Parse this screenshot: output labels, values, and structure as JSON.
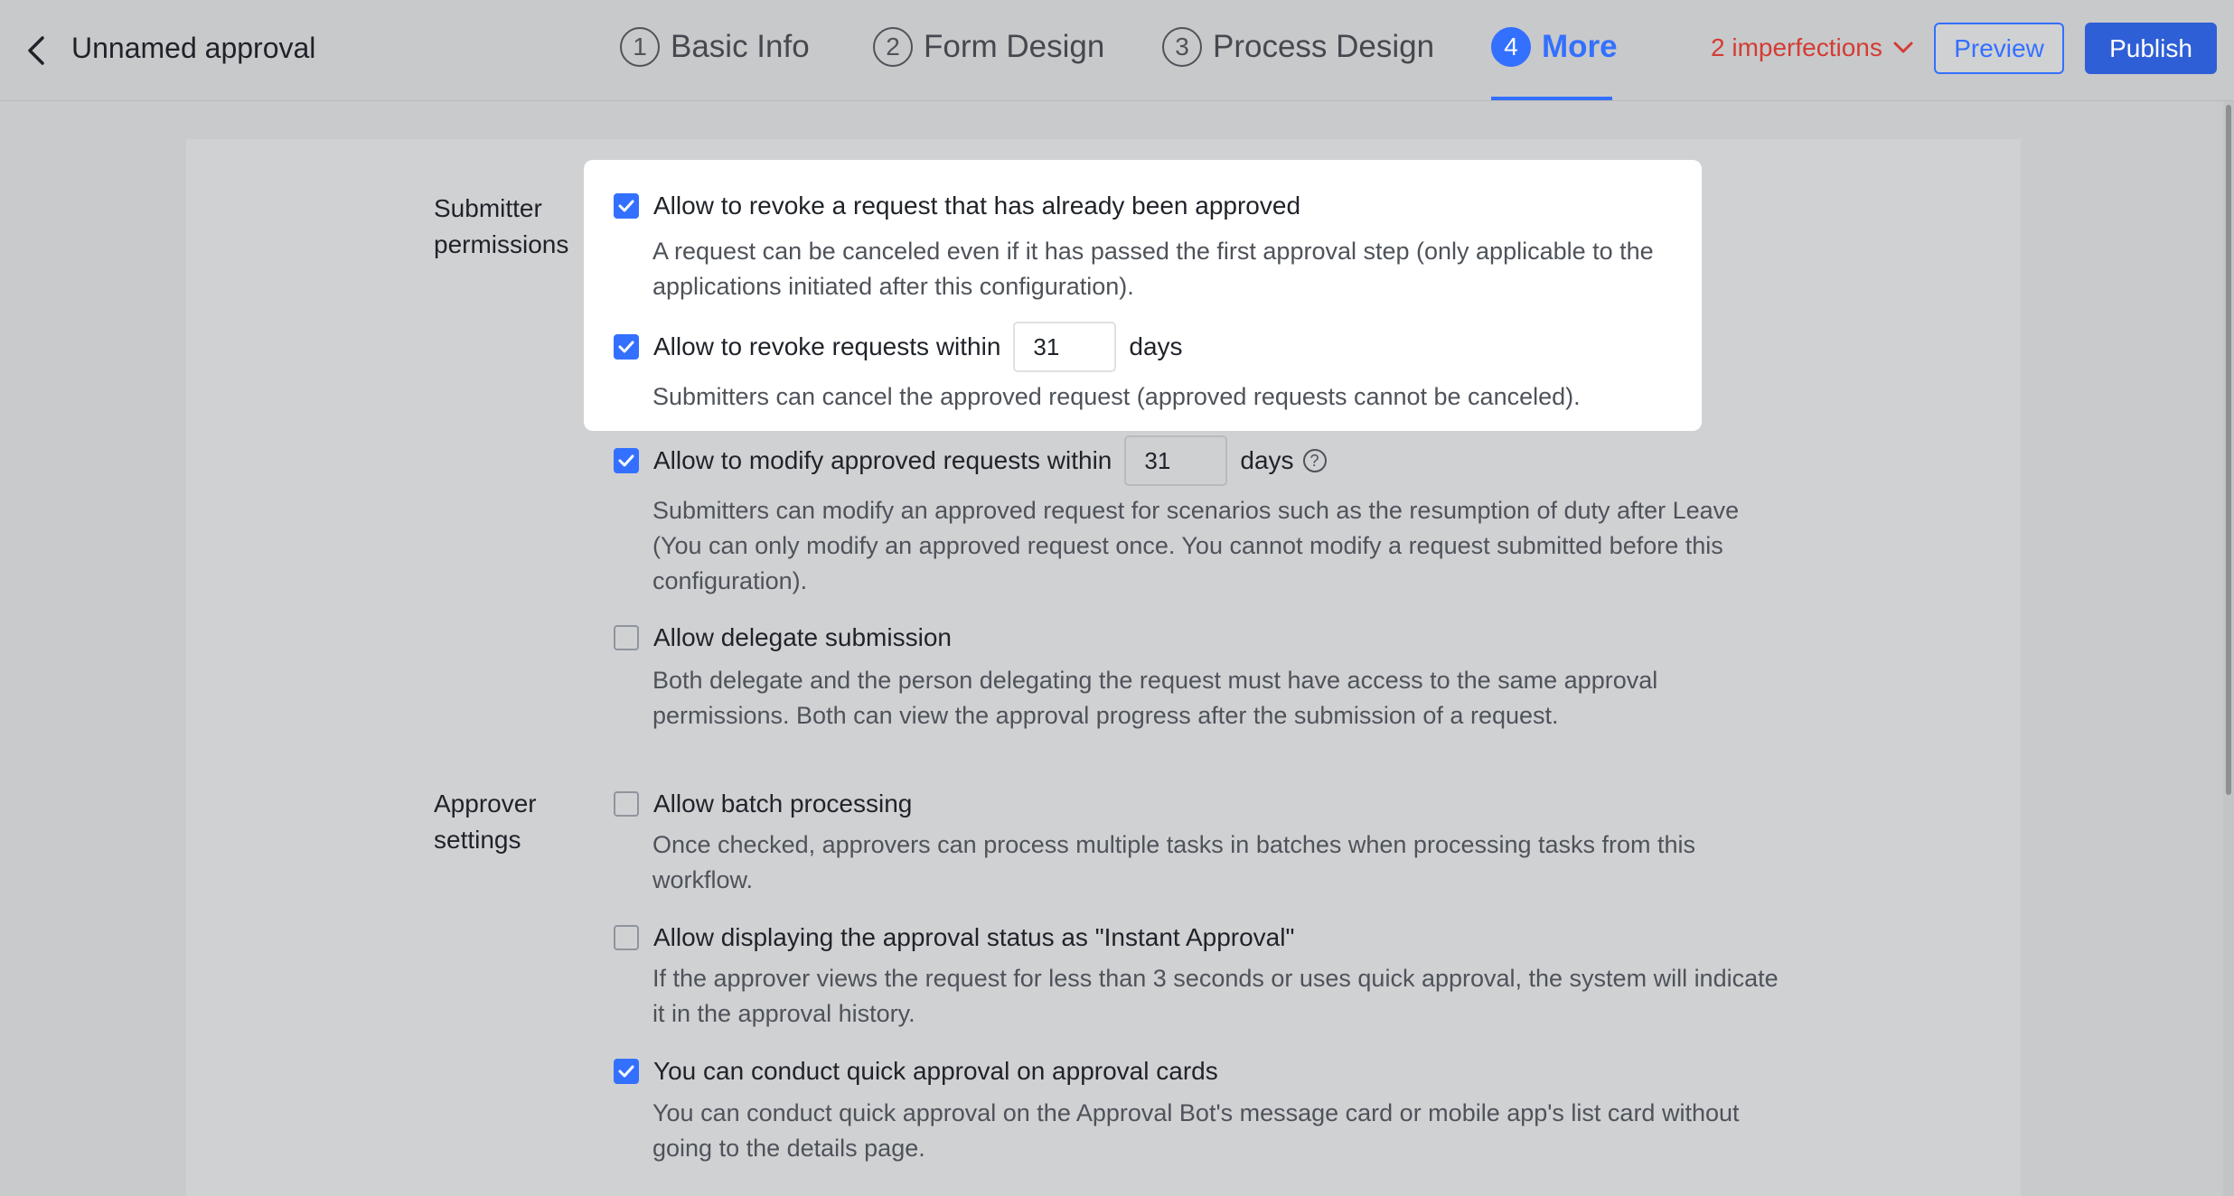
{
  "header": {
    "title": "Unnamed approval",
    "steps": [
      {
        "num": "1",
        "label": "Basic Info"
      },
      {
        "num": "2",
        "label": "Form Design"
      },
      {
        "num": "3",
        "label": "Process Design"
      },
      {
        "num": "4",
        "label": "More"
      }
    ],
    "active_step": 4,
    "imperfections": "2 imperfections",
    "preview": "Preview",
    "publish": "Publish"
  },
  "submitter": {
    "label": "Submitter permissions",
    "options": [
      {
        "label": "Allow to revoke a request that has already been approved",
        "checked": true,
        "desc": [
          "A request can be canceled even if it has passed the first approval step (only applicable to the",
          "applications initiated after this configuration)."
        ]
      },
      {
        "label": "Allow to revoke requests within",
        "value": "31",
        "unit": "days",
        "checked": true,
        "desc": [
          "Submitters can cancel the approved request (approved requests cannot be canceled)."
        ]
      },
      {
        "label": "Allow to modify approved requests within",
        "value": "31",
        "unit": "days",
        "checked": true,
        "desc": [
          "Submitters can modify an approved request for scenarios such as the resumption of duty after Leave",
          "(You can only modify an approved request once. You cannot modify a request submitted before this",
          "configuration)."
        ]
      },
      {
        "label": "Allow delegate submission",
        "checked": false,
        "desc": [
          "Both delegate and the person delegating the request must have access to the same approval",
          "permissions. Both can view the approval progress after the submission of a request."
        ]
      }
    ]
  },
  "approver": {
    "label": "Approver settings",
    "options": [
      {
        "label": "Allow batch processing",
        "checked": false,
        "desc": [
          "Once checked, approvers can process multiple tasks in batches when processing tasks from this",
          "workflow."
        ]
      },
      {
        "label": "Allow displaying the approval status as \"Instant Approval\"",
        "checked": false,
        "desc": [
          "If the approver views the request for less than 3 seconds or uses quick approval, the system will indicate",
          "it in the approval history."
        ]
      },
      {
        "label": "You can conduct quick approval on approval cards",
        "checked": true,
        "desc": [
          "You can conduct quick approval on the Approval Bot's message card or mobile app's list card without",
          "going to the details page."
        ]
      }
    ]
  },
  "colors": {
    "accent": "#3370ff",
    "error": "#d43c33"
  },
  "icons": {
    "back": "chevron-left-icon",
    "dropdown": "chevron-down-icon",
    "check": "check-icon",
    "help": "question-circle-icon"
  }
}
